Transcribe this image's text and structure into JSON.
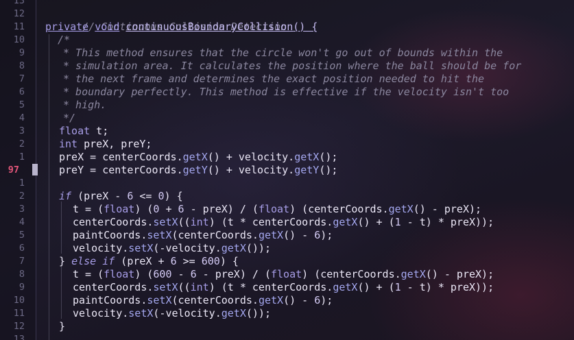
{
  "editor": {
    "current_line_number": "97",
    "line_numbers": [
      "13",
      "12",
      "11",
      "10",
      "9",
      "8",
      "7",
      "6",
      "5",
      "4",
      "3",
      "2",
      "1",
      "97",
      "1",
      "2",
      "3",
      "4",
      "5",
      "6",
      "7",
      "8",
      "9",
      "10",
      "11",
      "12",
      "13"
    ],
    "code": {
      "l12": "// Continuous Collision Detection",
      "l11_kw1": "private",
      "l11_kw2": "void",
      "l11_fn": "continuousBoundaryCollision",
      "l11_rest": "() {",
      "l10": "/*",
      "l9": "* This method ensures that the circle won't go out of bounds within the",
      "l8": "* simulation area. It calculates the position where the ball should be for",
      "l7": "* the next frame and determines the exact position needed to hit the",
      "l6": "* boundary perfectly. This method is effective if the velocity isn't too",
      "l5": "* high.",
      "l4": "*/",
      "l3_kw": "float",
      "l3_rest": " t;",
      "l2_kw": "int",
      "l2_rest": " preX, preY;",
      "l1_a": "preX = centerCoords.",
      "l1_m1": "getX",
      "l1_b": "() + velocity.",
      "l1_m2": "getX",
      "l1_c": "();",
      "l97_a": "preY = centerCoords.",
      "l97_m1": "getY",
      "l97_b": "() + velocity.",
      "l97_m2": "getY",
      "l97_c": "();",
      "r2_kw": "if",
      "r2_a": " (preX - ",
      "r2_n1": "6",
      "r2_b": " <= ",
      "r2_n2": "0",
      "r2_c": ") {",
      "r3_a": "t = (",
      "r3_kw1": "float",
      "r3_b": ") (",
      "r3_n1": "0",
      "r3_c": " + ",
      "r3_n2": "6",
      "r3_d": " - preX) / (",
      "r3_kw2": "float",
      "r3_e": ") (centerCoords.",
      "r3_m": "getX",
      "r3_f": "() - preX);",
      "r4_a": "centerCoords.",
      "r4_m1": "setX",
      "r4_b": "((",
      "r4_kw": "int",
      "r4_c": ") (t * centerCoords.",
      "r4_m2": "getX",
      "r4_d": "() + (",
      "r4_n": "1",
      "r4_e": " - t) * preX));",
      "r5_a": "paintCoords.",
      "r5_m1": "setX",
      "r5_b": "(centerCoords.",
      "r5_m2": "getX",
      "r5_c": "() - ",
      "r5_n": "6",
      "r5_d": ");",
      "r6_a": "velocity.",
      "r6_m1": "setX",
      "r6_b": "(-velocity.",
      "r6_m2": "getX",
      "r6_c": "());",
      "r7_a": "} ",
      "r7_kw": "else if",
      "r7_b": " (preX + ",
      "r7_n1": "6",
      "r7_c": " >= ",
      "r7_n2": "600",
      "r7_d": ") {",
      "r8_a": "t = (",
      "r8_kw1": "float",
      "r8_b": ") (",
      "r8_n1": "600",
      "r8_c": " - ",
      "r8_n2": "6",
      "r8_d": " - preX) / (",
      "r8_kw2": "float",
      "r8_e": ") (centerCoords.",
      "r8_m": "getX",
      "r8_f": "() - preX);",
      "r9_a": "centerCoords.",
      "r9_m1": "setX",
      "r9_b": "((",
      "r9_kw": "int",
      "r9_c": ") (t * centerCoords.",
      "r9_m2": "getX",
      "r9_d": "() + (",
      "r9_n": "1",
      "r9_e": " - t) * preX));",
      "r10_a": "paintCoords.",
      "r10_m1": "setX",
      "r10_b": "(centerCoords.",
      "r10_m2": "getX",
      "r10_c": "() - ",
      "r10_n": "6",
      "r10_d": ");",
      "r11_a": "velocity.",
      "r11_m1": "setX",
      "r11_b": "(-velocity.",
      "r11_m2": "getX",
      "r11_c": "());",
      "r12": "}"
    }
  }
}
